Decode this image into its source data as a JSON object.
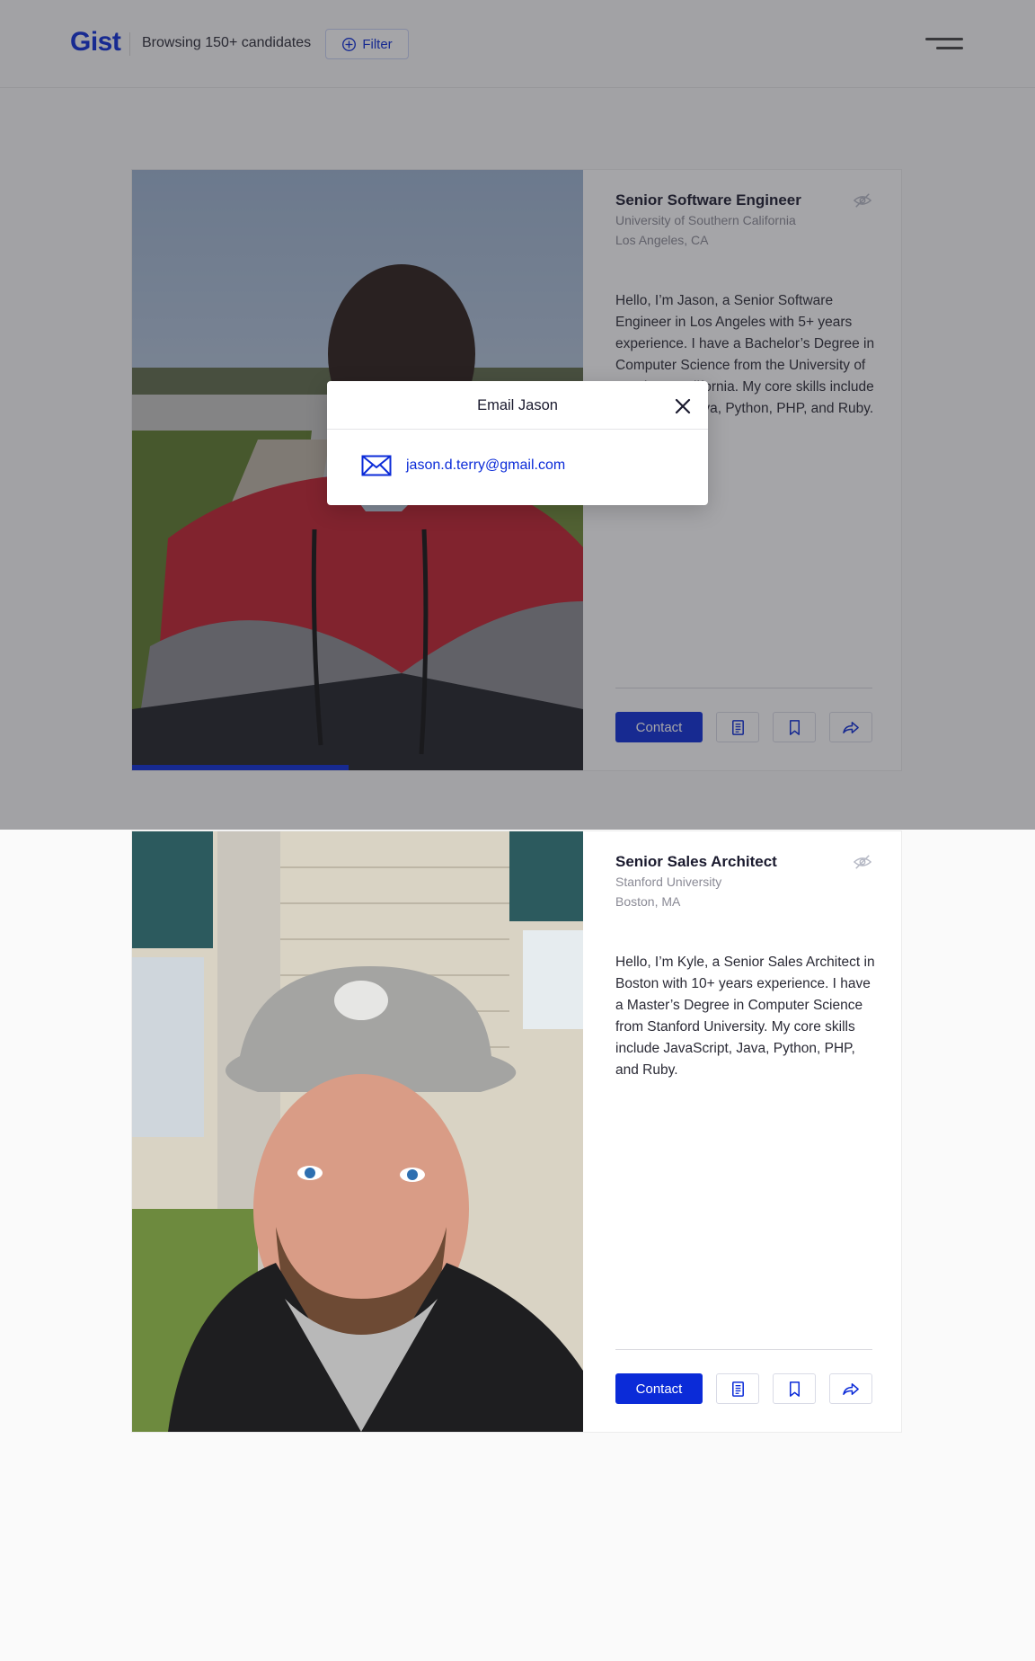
{
  "header": {
    "logo": "Gist",
    "browsing_text": "Browsing 150+ candidates",
    "filter_label": "Filter"
  },
  "candidates": [
    {
      "title": "Senior Software Engineer",
      "school": "University of Southern California",
      "location": "Los Angeles, CA",
      "bio": "Hello, I’m Jason, a Senior Software Engineer in Los Angeles with 5+ years experience. I have a Bachelor’s Degree in Computer Science from the University of Southern California. My core skills include JavaScript, Java, Python, PHP, and Ruby.",
      "contact_label": "Contact",
      "progress": 0.48
    },
    {
      "title": "Senior Sales Architect",
      "school": "Stanford University",
      "location": "Boston, MA",
      "bio": "Hello, I’m Kyle, a Senior Sales Architect in Boston with 10+ years experience. I have a Master’s Degree in Computer Science from Stanford University. My core skills include JavaScript, Java, Python, PHP, and Ruby.",
      "contact_label": "Contact"
    }
  ],
  "modal": {
    "title": "Email Jason",
    "email": "jason.d.terry@gmail.com"
  },
  "colors": {
    "accent": "#0b2bd8",
    "overlay": "rgba(40,40,48,0.42)"
  },
  "icons": [
    "filter-plus-icon",
    "menu-icon",
    "hide-eye-icon",
    "resume-icon",
    "bookmark-icon",
    "share-icon",
    "close-icon",
    "mail-icon"
  ]
}
